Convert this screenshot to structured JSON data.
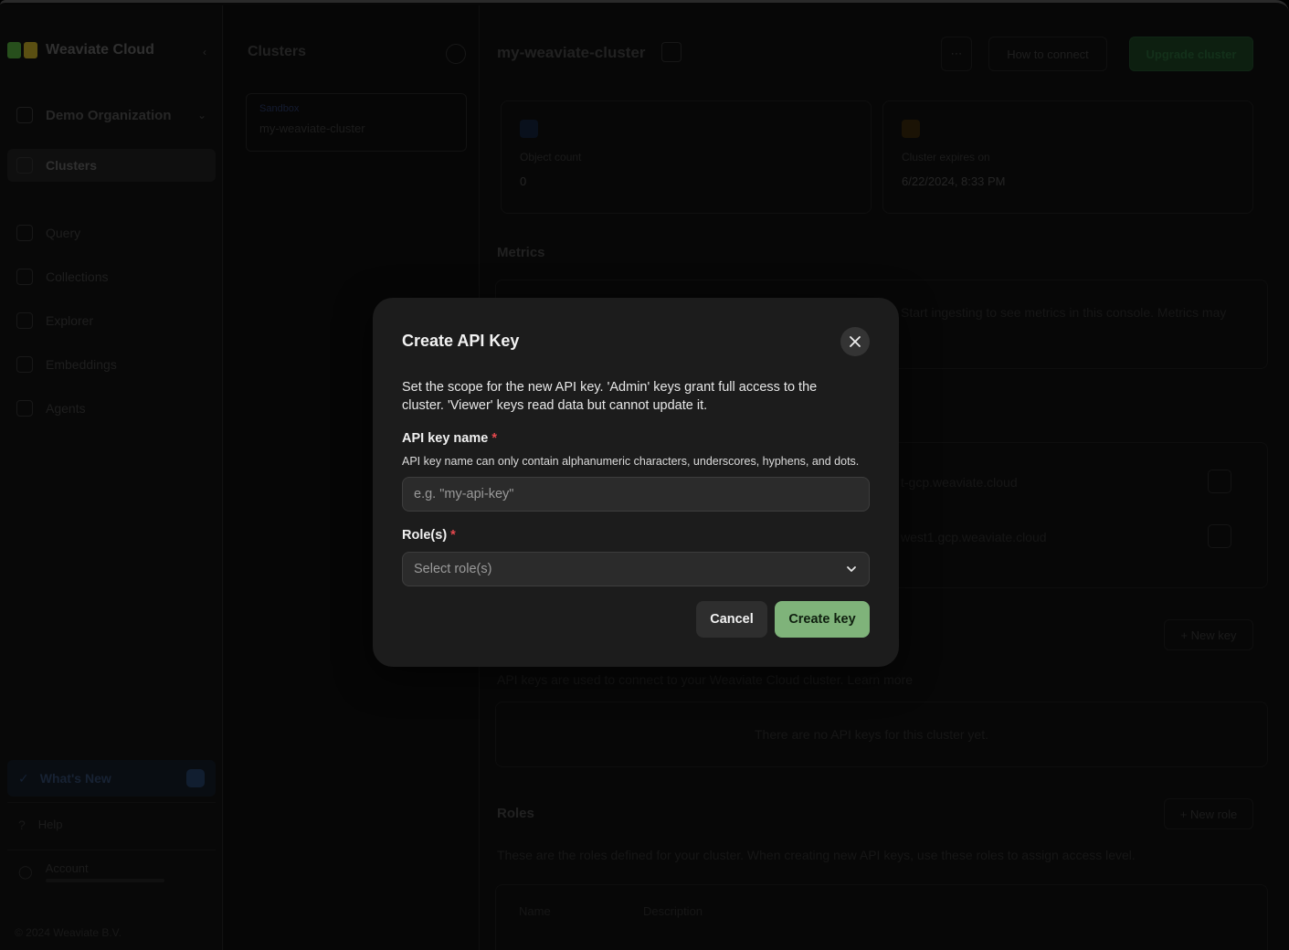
{
  "sidebar": {
    "brand": "Weaviate Cloud",
    "organization": "Demo Organization",
    "items": [
      {
        "label": "Clusters"
      },
      {
        "label": "Query"
      },
      {
        "label": "Collections"
      },
      {
        "label": "Explorer"
      },
      {
        "label": "Embeddings"
      },
      {
        "label": "Agents"
      }
    ],
    "whats_new": "What's New",
    "help": "Help",
    "account": "Account",
    "footer": "© 2024 Weaviate B.V."
  },
  "clusters_panel": {
    "title": "Clusters",
    "cluster": {
      "env": "Sandbox",
      "name": "my-weaviate-cluster"
    }
  },
  "main": {
    "title": "my-weaviate-cluster",
    "how_to_connect": "How to connect",
    "primary_action": "Upgrade cluster",
    "stats": [
      {
        "label": "Object count",
        "value": "0"
      },
      {
        "label": "Cluster expires on",
        "value": "6/22/2024, 8:33 PM"
      }
    ],
    "metrics_title": "Metrics",
    "metrics_text": "Start ingesting to see metrics in this console. Metrics may",
    "endpoint_1": "t-gcp.weaviate.cloud",
    "endpoint_2": "west1.gcp.weaviate.cloud",
    "api_keys_text": "API keys are used to connect to your Weaviate Cloud cluster. Learn more",
    "new_key": "+ New key",
    "no_keys": "There are no API keys for this cluster yet.",
    "roles_title": "Roles",
    "new_role": "+ New role",
    "roles_text": "These are the roles defined for your cluster. When creating new API keys, use these roles to assign access level.",
    "roles_columns": [
      "Name",
      "Description"
    ]
  },
  "modal": {
    "title": "Create API Key",
    "description": "Set the scope for the new API key. 'Admin' keys grant full access to the cluster. 'Viewer' keys read data but cannot update it.",
    "name_label": "API key name",
    "required_mark": "*",
    "name_hint": "API key name can only contain alphanumeric characters, underscores, hyphens, and dots.",
    "name_placeholder": "e.g. \"my-api-key\"",
    "roles_label": "Role(s)",
    "roles_placeholder": "Select role(s)",
    "cancel": "Cancel",
    "create": "Create key"
  },
  "colors": {
    "accent_green": "#7fb37a",
    "required_red": "#e5484d",
    "modal_bg": "#1c1c1c"
  }
}
